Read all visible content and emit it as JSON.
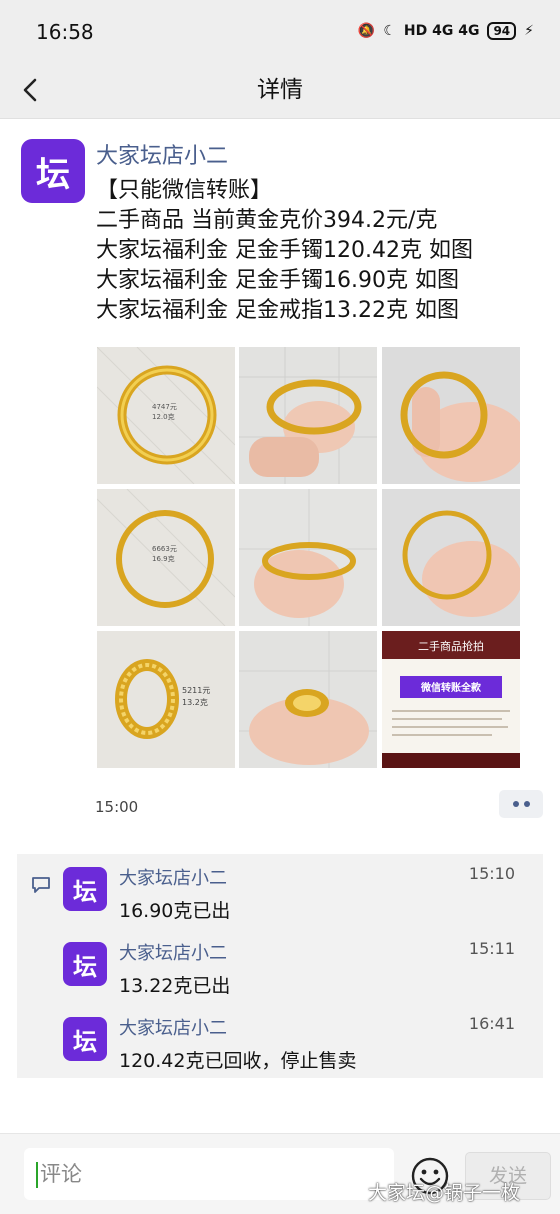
{
  "status_bar": {
    "time": "16:58",
    "network": "HD 4G 4G",
    "battery": "94"
  },
  "nav": {
    "title": "详情"
  },
  "post": {
    "avatar_text": "坛",
    "author": "大家坛店小二",
    "lines": [
      "【只能微信转账】",
      "二手商品 当前黄金克价394.2元/克",
      "大家坛福利金 足金手镯120.42克 如图",
      "大家坛福利金 足金手镯16.90克 如图",
      "大家坛福利金 足金戒指13.22克 如图"
    ],
    "time": "15:00",
    "promo_image": {
      "header": "二手商品抢拍",
      "button": "微信转账全款"
    }
  },
  "comments": [
    {
      "author": "大家坛店小二",
      "time": "15:10",
      "text": "16.90克已出"
    },
    {
      "author": "大家坛店小二",
      "time": "15:11",
      "text": "13.22克已出"
    },
    {
      "author": "大家坛店小二",
      "time": "16:41",
      "text": "120.42克已回收，停止售卖"
    }
  ],
  "input": {
    "placeholder": "评论",
    "send_label": "发送"
  },
  "watermark": "大家坛@锅子一枚",
  "colors": {
    "brand": "#6c2bd9",
    "name": "#4a5f8d",
    "gold": "#d9a520"
  }
}
